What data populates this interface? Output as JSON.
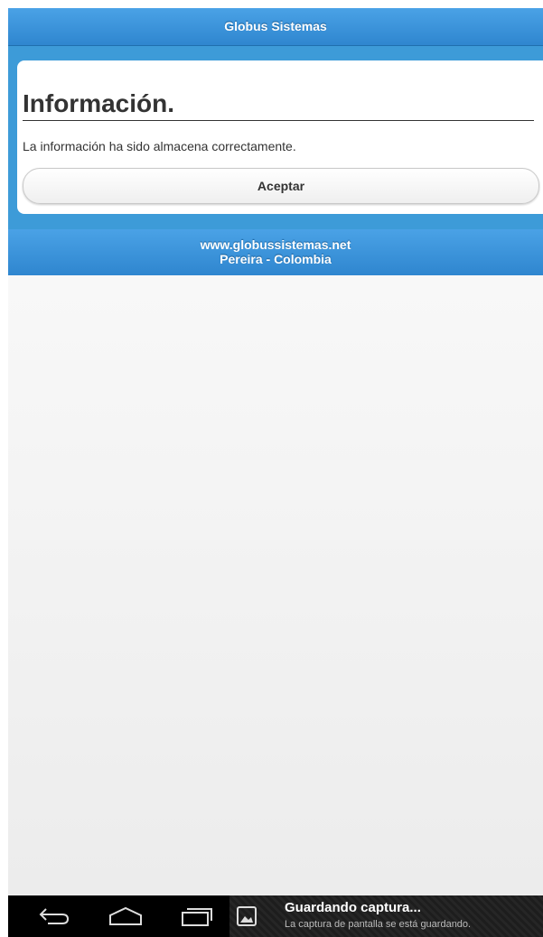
{
  "header": {
    "title": "Globus Sistemas"
  },
  "dialog": {
    "title": "Información.",
    "message": "La información ha sido almacena correctamente.",
    "accept_label": "Aceptar"
  },
  "footer": {
    "website": "www.globussistemas.net",
    "location": "Pereira - Colombia"
  },
  "notification": {
    "icon": "image-icon",
    "title": "Guardando captura...",
    "subtitle": "La captura de pantalla se está guardando."
  },
  "navbar": {
    "buttons": [
      "back-icon",
      "home-icon",
      "recent-apps-icon"
    ]
  }
}
